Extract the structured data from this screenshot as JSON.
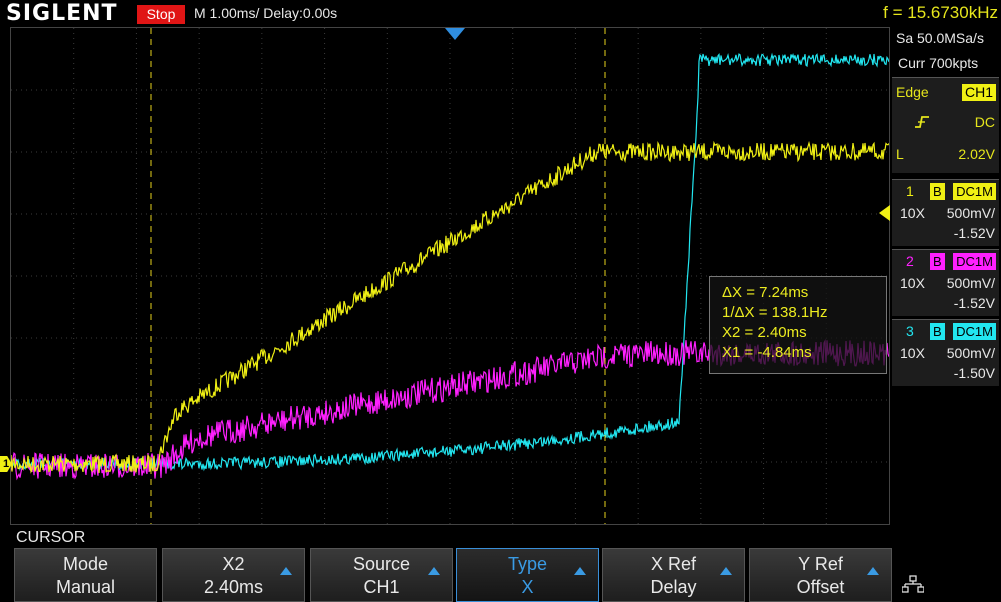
{
  "header": {
    "brand": "SIGLENT",
    "run_state": "Stop",
    "timebase": "M 1.00ms/ Delay:0.00s",
    "frequency": "f = 15.6730kHz"
  },
  "acquisition": {
    "sample_rate": "Sa 50.0MSa/s",
    "memory": "Curr 700kpts"
  },
  "trigger": {
    "type": "Edge",
    "source": "CH1",
    "slope_icon": "rising-edge-icon",
    "coupling": "DC",
    "level_label": "L",
    "level": "2.02V"
  },
  "channels": [
    {
      "num": "1",
      "bw": "B",
      "coupling": "DC1M",
      "probe": "10X",
      "scale": "500mV/",
      "offset": "-1.52V",
      "color": "#f0f014"
    },
    {
      "num": "2",
      "bw": "B",
      "coupling": "DC1M",
      "probe": "10X",
      "scale": "500mV/",
      "offset": "-1.52V",
      "color": "#ff20ff"
    },
    {
      "num": "3",
      "bw": "B",
      "coupling": "DC1M",
      "probe": "10X",
      "scale": "500mV/",
      "offset": "-1.50V",
      "color": "#22e6f0"
    }
  ],
  "cursor_readout": {
    "dx": "ΔX = 7.24ms",
    "inv_dx": "1/ΔX = 138.1Hz",
    "x2": "X2 = 2.40ms",
    "x1": "X1 = -4.84ms"
  },
  "ground_marker": "1",
  "menu": {
    "title": "CURSOR",
    "items": [
      {
        "label": "Mode",
        "value": "Manual",
        "arrow": false
      },
      {
        "label": "X2",
        "value": "2.40ms",
        "arrow": true
      },
      {
        "label": "Source",
        "value": "CH1",
        "arrow": true
      },
      {
        "label": "Type",
        "value": "X",
        "arrow": true
      },
      {
        "label": "X Ref",
        "value": "Delay",
        "arrow": true
      },
      {
        "label": "Y Ref",
        "value": "Offset",
        "arrow": true
      }
    ],
    "network_icon": "network-icon"
  }
}
